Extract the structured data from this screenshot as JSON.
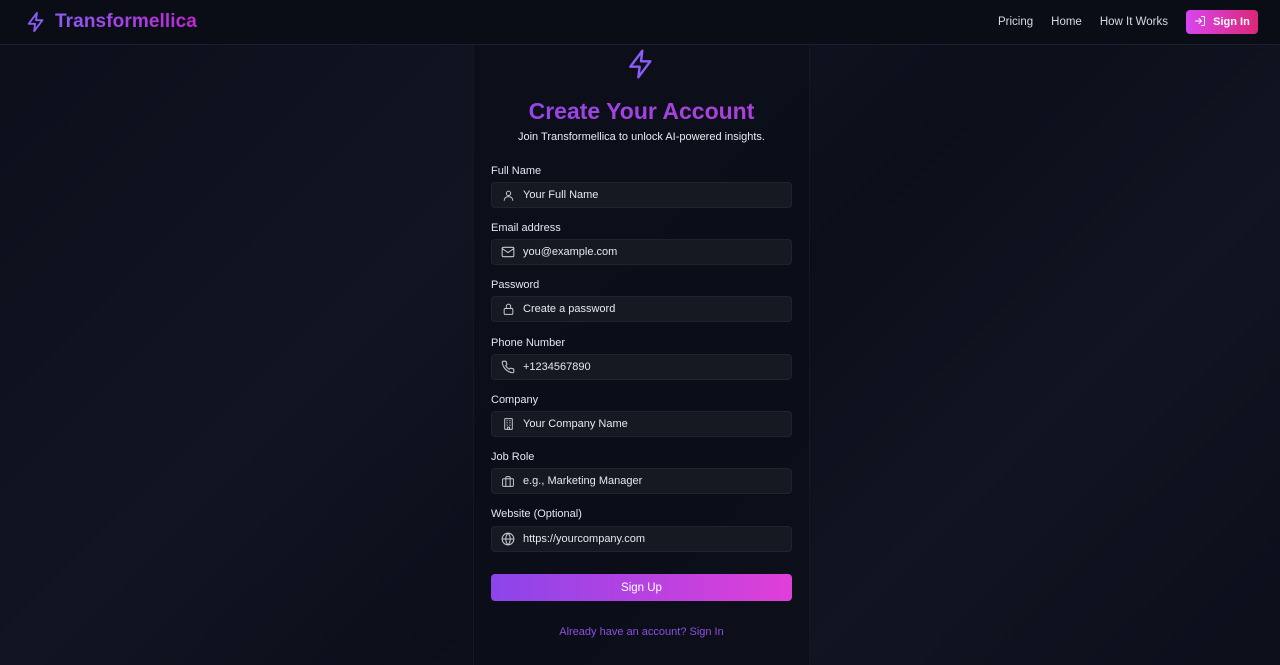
{
  "nav": {
    "brand": "Transformellica",
    "links": [
      "Pricing",
      "Home",
      "How It Works"
    ],
    "signin_label": "Sign In"
  },
  "form": {
    "title": "Create Your Account",
    "subtitle": "Join Transformellica to unlock AI-powered insights.",
    "fields": [
      {
        "label": "Full Name",
        "placeholder": "Your Full Name",
        "icon": "user-icon"
      },
      {
        "label": "Email address",
        "placeholder": "you@example.com",
        "icon": "mail-icon"
      },
      {
        "label": "Password",
        "placeholder": "Create a password",
        "icon": "lock-icon"
      },
      {
        "label": "Phone Number",
        "placeholder": "+1234567890",
        "icon": "phone-icon"
      },
      {
        "label": "Company",
        "placeholder": "Your Company Name",
        "icon": "building-icon"
      },
      {
        "label": "Job Role",
        "placeholder": "e.g., Marketing Manager",
        "icon": "briefcase-icon"
      },
      {
        "label": "Website (Optional)",
        "placeholder": "https://yourcompany.com",
        "icon": "globe-icon"
      }
    ],
    "submit_label": "Sign Up",
    "signin_link": "Already have an account? Sign In"
  },
  "colors": {
    "accent_purple": "#8b5cf6",
    "accent_pink": "#d946ef",
    "background": "#0b0f1a"
  }
}
